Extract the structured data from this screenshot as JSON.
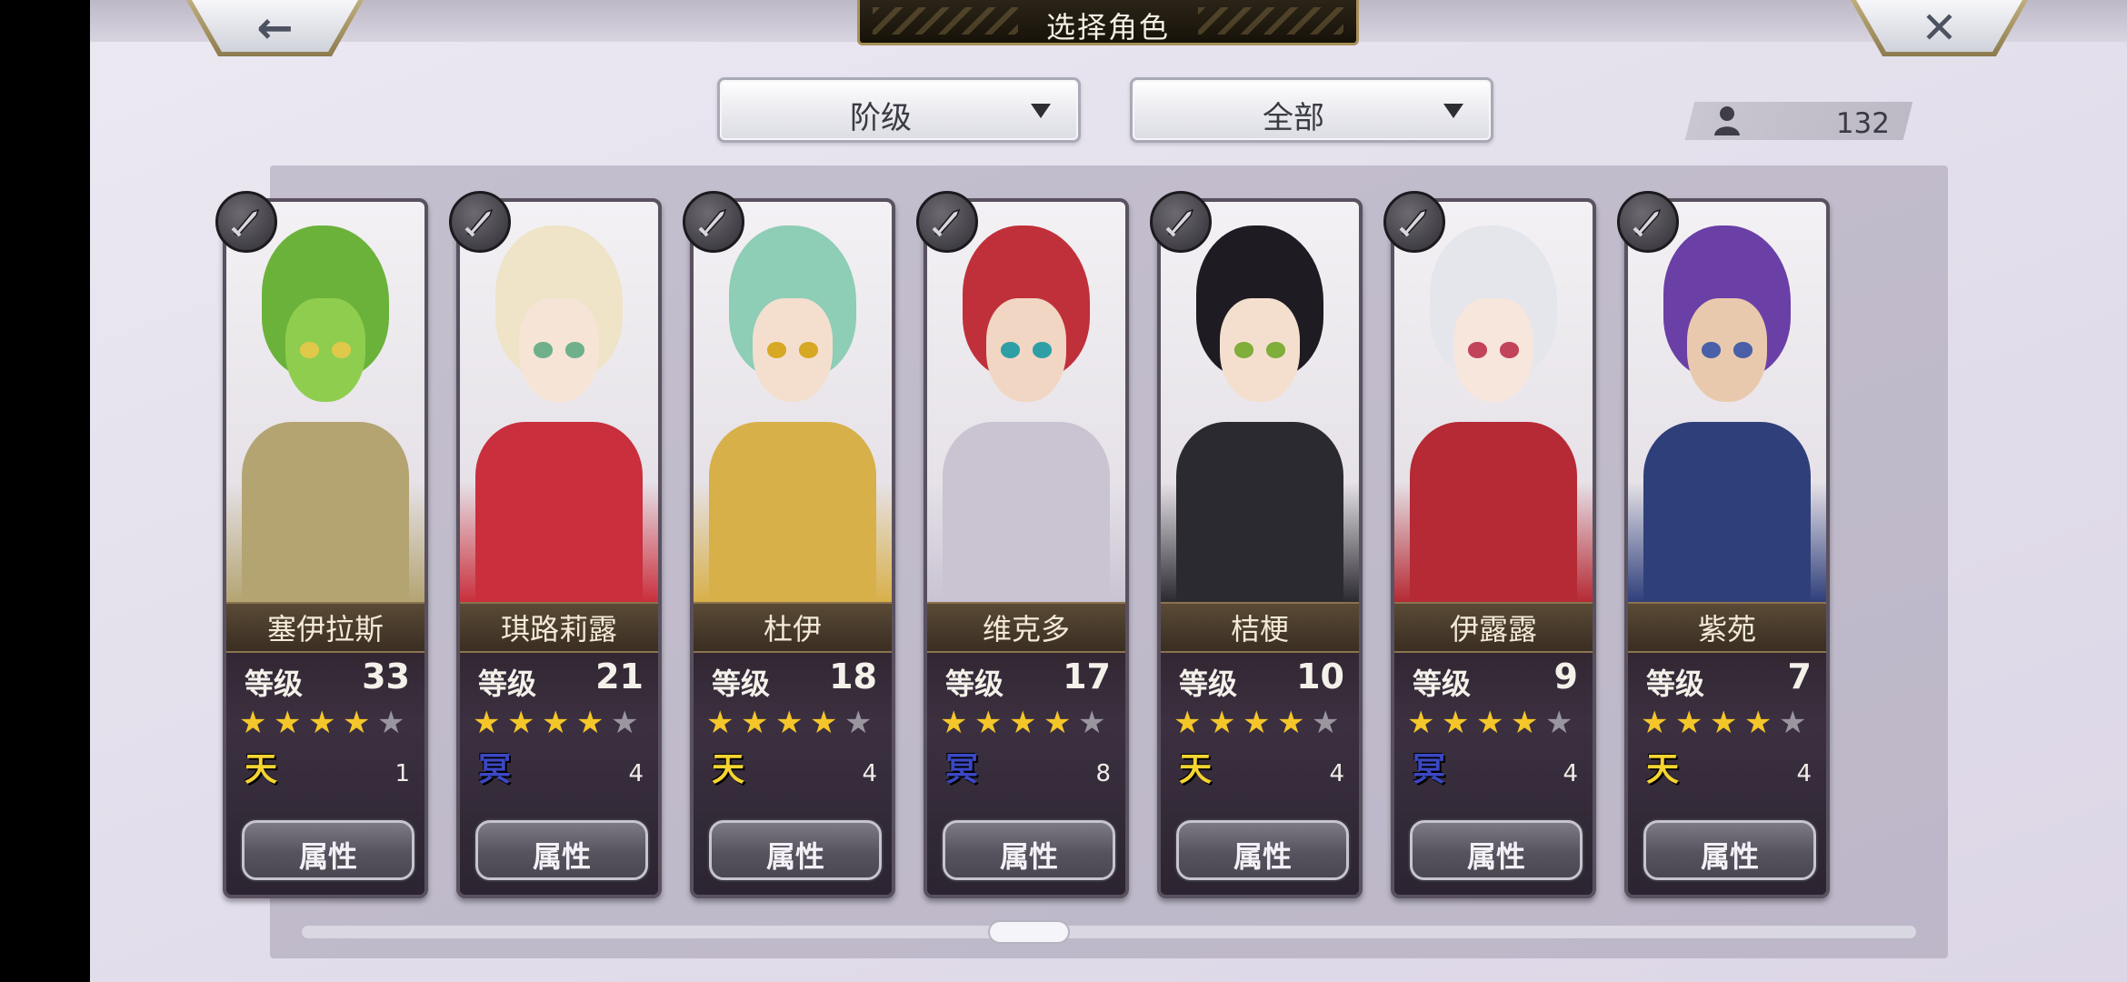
{
  "header": {
    "title": "选择角色",
    "back_glyph": "←",
    "close_glyph": "✕"
  },
  "filters": {
    "rank_label": "阶级",
    "scope_label": "全部"
  },
  "roster_count": "132",
  "characters": [
    {
      "name": "塞伊拉斯",
      "level_label": "等级",
      "level": "33",
      "stars": 4,
      "max_stars": 5,
      "badge": "天",
      "badge_color": "#f5d432",
      "count": "1",
      "attr_label": "属性",
      "weapon": "sword-icon",
      "hair": "#6bb23a",
      "skin": "#8fcd4f",
      "body": "#b4a472",
      "eye": "#e0c84a"
    },
    {
      "name": "琪路莉露",
      "level_label": "等级",
      "level": "21",
      "stars": 4,
      "max_stars": 5,
      "badge": "冥",
      "badge_color": "#3b48c4",
      "count": "4",
      "attr_label": "属性",
      "weapon": "greatsword-icon",
      "hair": "#efe3c8",
      "skin": "#f6e4d6",
      "body": "#c92f3c",
      "eye": "#6fb08b"
    },
    {
      "name": "杜伊",
      "level_label": "等级",
      "level": "18",
      "stars": 4,
      "max_stars": 5,
      "badge": "天",
      "badge_color": "#f5d432",
      "count": "4",
      "attr_label": "属性",
      "weapon": "fist-icon",
      "hair": "#8ecdb6",
      "skin": "#f4dfcf",
      "body": "#d8b04a",
      "eye": "#d6a824"
    },
    {
      "name": "维克多",
      "level_label": "等级",
      "level": "17",
      "stars": 4,
      "max_stars": 5,
      "badge": "冥",
      "badge_color": "#3b48c4",
      "count": "8",
      "attr_label": "属性",
      "weapon": "sword-icon",
      "hair": "#c0303a",
      "skin": "#f1d6c3",
      "body": "#c9c3d2",
      "eye": "#2f9fa6"
    },
    {
      "name": "桔梗",
      "level_label": "等级",
      "level": "10",
      "stars": 4,
      "max_stars": 5,
      "badge": "天",
      "badge_color": "#f5d432",
      "count": "4",
      "attr_label": "属性",
      "weapon": "axe-icon",
      "hair": "#1e1c22",
      "skin": "#f4dfcf",
      "body": "#2b2a30",
      "eye": "#7fae3a"
    },
    {
      "name": "伊露露",
      "level_label": "等级",
      "level": "9",
      "stars": 4,
      "max_stars": 5,
      "badge": "冥",
      "badge_color": "#3b48c4",
      "count": "4",
      "attr_label": "属性",
      "weapon": "axe-icon",
      "hair": "#e4e6ec",
      "skin": "#f6e6dc",
      "body": "#b52a34",
      "eye": "#c2445a"
    },
    {
      "name": "紫苑",
      "level_label": "等级",
      "level": "7",
      "stars": 4,
      "max_stars": 5,
      "badge": "天",
      "badge_color": "#f5d432",
      "count": "4",
      "attr_label": "属性",
      "weapon": "sword-icon",
      "hair": "#6a3fa6",
      "skin": "#e9c9ad",
      "body": "#2f3f7a",
      "eye": "#4a5fa8"
    }
  ],
  "colors": {
    "star_on": "#f5c62a",
    "star_off": "#9a96a0"
  },
  "icons": {
    "user": "user-icon"
  }
}
